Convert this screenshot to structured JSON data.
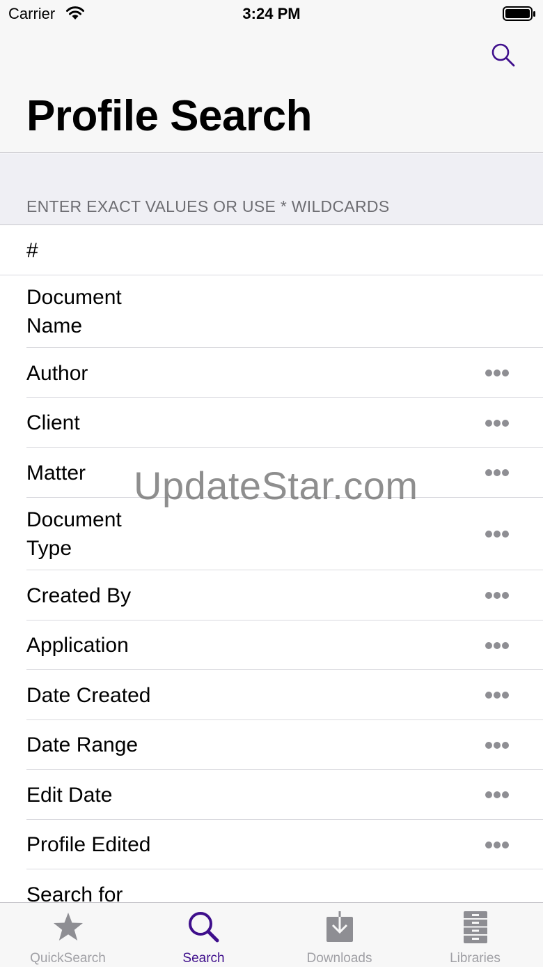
{
  "status_bar": {
    "carrier": "Carrier",
    "time": "3:24 PM"
  },
  "header": {
    "title": "Profile Search",
    "search_icon": "search-icon"
  },
  "section": {
    "title": "ENTER EXACT VALUES OR USE * WILDCARDS"
  },
  "fields": [
    {
      "label": "#",
      "lookup": false
    },
    {
      "label": "Document Name",
      "lookup": false
    },
    {
      "label": "Author",
      "lookup": true
    },
    {
      "label": "Client",
      "lookup": true
    },
    {
      "label": "Matter",
      "lookup": true
    },
    {
      "label": "Document Type",
      "lookup": true
    },
    {
      "label": "Created By",
      "lookup": true
    },
    {
      "label": "Application",
      "lookup": true
    },
    {
      "label": "Date Created",
      "lookup": true
    },
    {
      "label": "Date Range",
      "lookup": true
    },
    {
      "label": "Edit Date",
      "lookup": true
    },
    {
      "label": "Profile Edited",
      "lookup": true
    },
    {
      "label": "Search for",
      "lookup": false
    }
  ],
  "watermark": "UpdateStar.com",
  "tabs": [
    {
      "label": "QuickSearch",
      "icon": "star-icon",
      "active": false
    },
    {
      "label": "Search",
      "icon": "search-icon",
      "active": true
    },
    {
      "label": "Downloads",
      "icon": "download-icon",
      "active": false
    },
    {
      "label": "Libraries",
      "icon": "cabinet-icon",
      "active": false
    }
  ],
  "colors": {
    "accent": "#3f0f8c",
    "inactive": "#a0a0a5",
    "ellipsis": "#8e8e93"
  }
}
